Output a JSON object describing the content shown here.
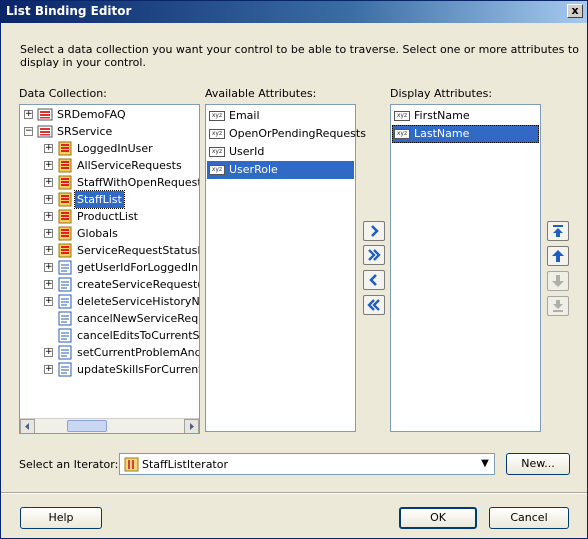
{
  "window": {
    "title": "List Binding Editor",
    "close_glyph": "x"
  },
  "description": "Select a data collection you want your control to be able to traverse. Select one or more attributes to display in your control.",
  "labels": {
    "data_collection": "Data Collection:",
    "available_attributes": "Available Attributes:",
    "display_attributes": "Display Attributes:",
    "iterator": "Select an Iterator:"
  },
  "tree": {
    "items": [
      {
        "label": "SRDemoFAQ",
        "icon": "datacontrol-icon",
        "expander": "+"
      },
      {
        "label": "SRService",
        "icon": "datacontrol-icon",
        "expander": "−"
      },
      {
        "label": "LoggedInUser",
        "icon": "collection-icon",
        "expander": "+"
      },
      {
        "label": "AllServiceRequests",
        "icon": "collection-icon",
        "expander": "+"
      },
      {
        "label": "StaffWithOpenRequests",
        "icon": "collection-icon",
        "expander": "+"
      },
      {
        "label": "StaffList",
        "icon": "collection-icon",
        "expander": "+",
        "selected": true
      },
      {
        "label": "ProductList",
        "icon": "collection-icon",
        "expander": "+"
      },
      {
        "label": "Globals",
        "icon": "collection-icon",
        "expander": "+"
      },
      {
        "label": "ServiceRequestStatusList",
        "icon": "collection-icon",
        "expander": "+"
      },
      {
        "label": "getUserIdForLoggedInUser",
        "icon": "method-icon",
        "expander": "+"
      },
      {
        "label": "createServiceRequest(String",
        "icon": "method-icon",
        "expander": "+"
      },
      {
        "label": "deleteServiceHistoryNotes",
        "icon": "method-icon",
        "expander": "+"
      },
      {
        "label": "cancelNewServiceRequest",
        "icon": "method-icon",
        "expander": ""
      },
      {
        "label": "cancelEditsToCurrentService",
        "icon": "method-icon",
        "expander": ""
      },
      {
        "label": "setCurrentProblemAndAssign",
        "icon": "method-icon",
        "expander": "+"
      },
      {
        "label": "updateSkillsForCurrentStaff",
        "icon": "method-icon",
        "expander": "+"
      }
    ]
  },
  "available_attributes": [
    {
      "label": "Email",
      "icon": "xyz-attribute-icon"
    },
    {
      "label": "OpenOrPendingRequests",
      "icon": "xyz-attribute-icon"
    },
    {
      "label": "UserId",
      "icon": "xyz-attribute-icon"
    },
    {
      "label": "UserRole",
      "icon": "xyz-attribute-icon",
      "selected": true
    }
  ],
  "display_attributes": [
    {
      "label": "FirstName",
      "icon": "xyz-attribute-icon"
    },
    {
      "label": "LastName",
      "icon": "xyz-attribute-icon",
      "selected": true
    }
  ],
  "iterator": {
    "value": "StaffListIterator",
    "new_label": "New..."
  },
  "buttons": {
    "help": "Help",
    "ok": "OK",
    "cancel": "Cancel"
  },
  "colors": {
    "selection": "#316ac5",
    "dialog_bg": "#ece9d8",
    "title_bar": "#0a246a"
  }
}
